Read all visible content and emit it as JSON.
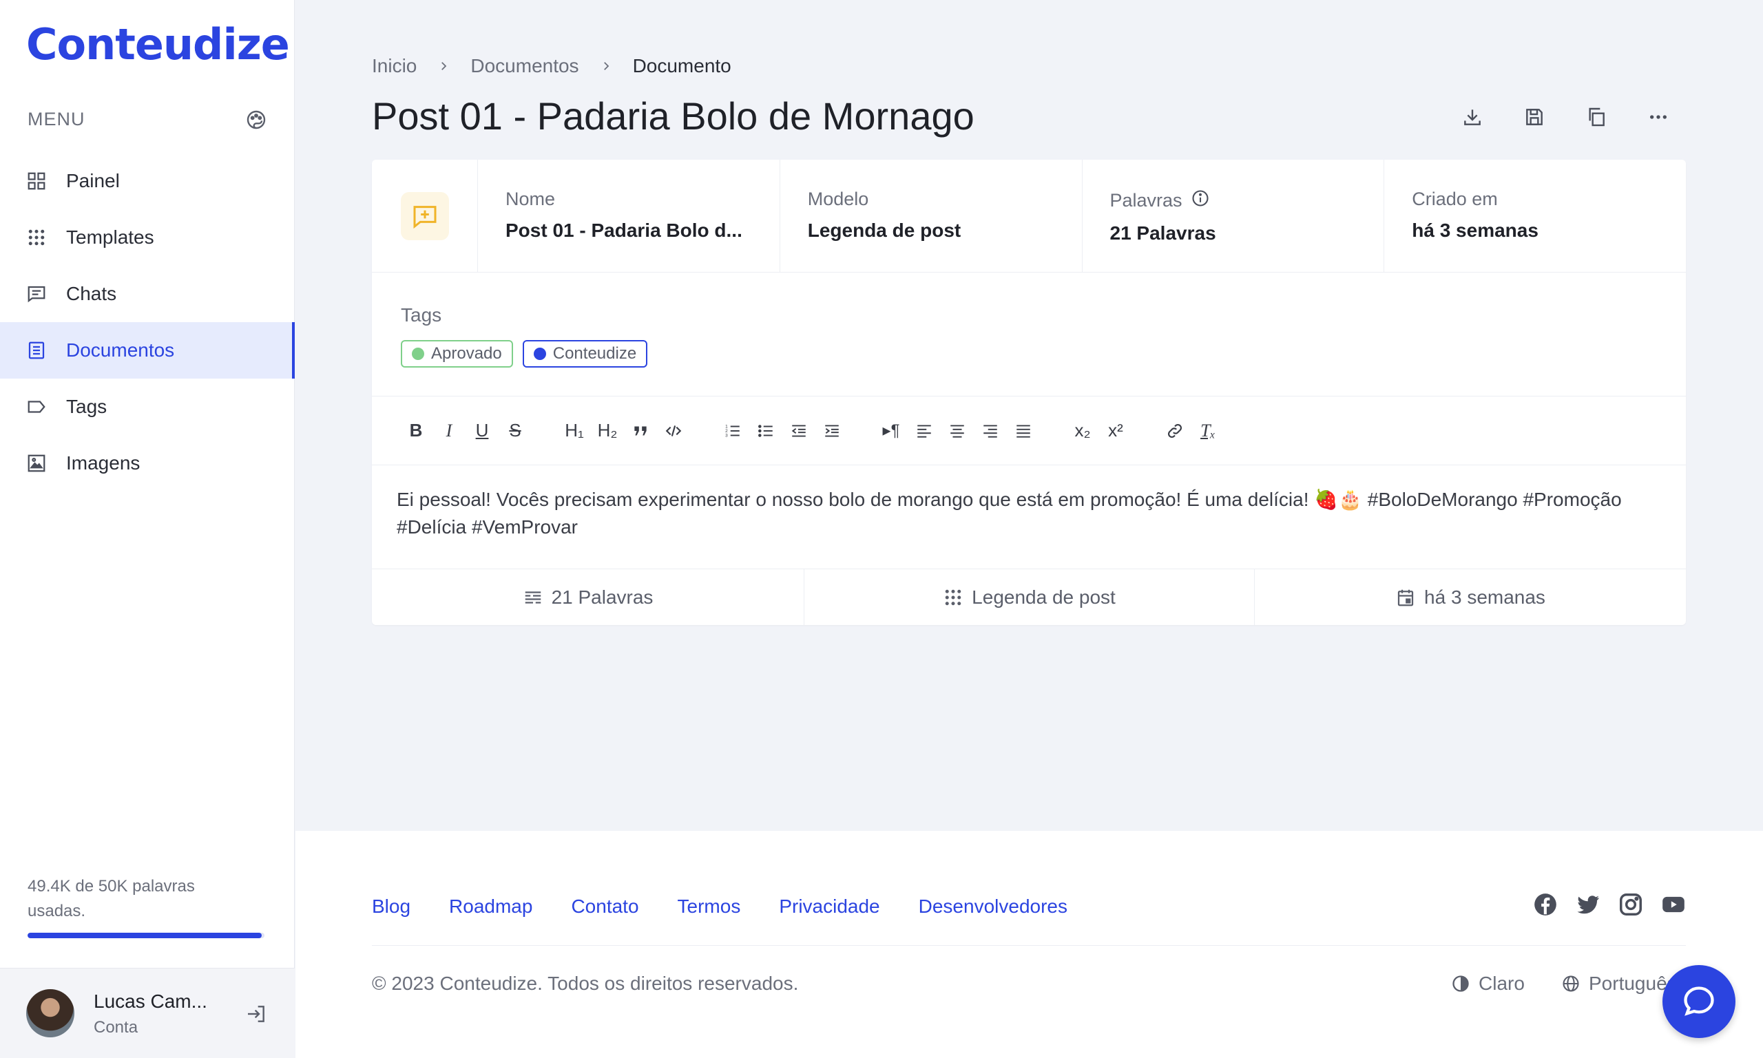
{
  "app": {
    "logo": "Conteudize",
    "accent": "#2b44e0"
  },
  "sidebar": {
    "menu_label": "MENU",
    "items": [
      {
        "label": "Painel",
        "icon": "grid-icon"
      },
      {
        "label": "Templates",
        "icon": "dots-grid-icon"
      },
      {
        "label": "Chats",
        "icon": "chat-icon"
      },
      {
        "label": "Documentos",
        "icon": "document-icon",
        "active": true
      },
      {
        "label": "Tags",
        "icon": "tag-icon"
      },
      {
        "label": "Imagens",
        "icon": "image-icon"
      }
    ],
    "usage_text": "49.4K de 50K palavras usadas.",
    "usage_fraction": 0.988,
    "user": {
      "name": "Lucas Cam...",
      "sub": "Conta"
    }
  },
  "breadcrumb": [
    "Inicio",
    "Documentos",
    "Documento"
  ],
  "page_title": "Post 01 - Padaria Bolo de Mornago",
  "info": {
    "name_label": "Nome",
    "name_value": "Post 01 - Padaria Bolo d...",
    "model_label": "Modelo",
    "model_value": "Legenda de post",
    "words_label": "Palavras",
    "words_value": "21 Palavras",
    "created_label": "Criado em",
    "created_value": "há 3 semanas"
  },
  "tags": {
    "label": "Tags",
    "items": [
      {
        "label": "Aprovado",
        "color": "#7fd08a"
      },
      {
        "label": "Conteudize",
        "color": "#2b44e0"
      }
    ]
  },
  "toolbar": {
    "h1": "H₁",
    "h2": "H₂",
    "sub": "x₂",
    "sup": "x²"
  },
  "editor_text": "Ei pessoal! Vocês precisam experimentar o nosso bolo de morango que está em promoção! É uma delícia! 🍓🎂 #BoloDeMorango #Promoção #Delícia #VemProvar",
  "stats": {
    "words": "21 Palavras",
    "model": "Legenda de post",
    "created": "há 3 semanas"
  },
  "footer": {
    "links": [
      "Blog",
      "Roadmap",
      "Contato",
      "Termos",
      "Privacidade",
      "Desenvolvedores"
    ],
    "copyright": "© 2023 Conteudize. Todos os direitos reservados.",
    "theme": "Claro",
    "language": "Português"
  }
}
